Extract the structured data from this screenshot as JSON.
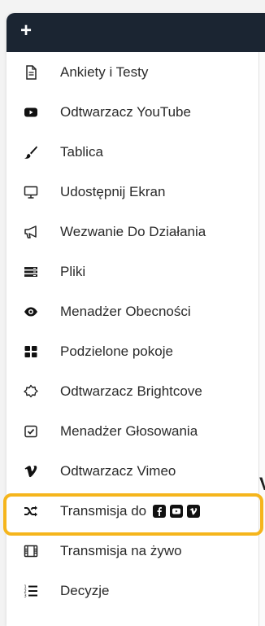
{
  "topbar": {
    "add_label": "+"
  },
  "menu": {
    "items": [
      {
        "label": "Ankiety i Testy",
        "icon": "document-icon"
      },
      {
        "label": "Odtwarzacz YouTube",
        "icon": "youtube-icon"
      },
      {
        "label": "Tablica",
        "icon": "brush-icon"
      },
      {
        "label": "Udostępnij Ekran",
        "icon": "monitor-icon"
      },
      {
        "label": "Wezwanie Do Działania",
        "icon": "megaphone-icon"
      },
      {
        "label": "Pliki",
        "icon": "files-icon"
      },
      {
        "label": "Menadżer Obecności",
        "icon": "eye-icon"
      },
      {
        "label": "Podzielone pokoje",
        "icon": "grid-icon"
      },
      {
        "label": "Odtwarzacz Brightcove",
        "icon": "brightcove-icon"
      },
      {
        "label": "Menadżer Głosowania",
        "icon": "checkbox-icon"
      },
      {
        "label": "Odtwarzacz Vimeo",
        "icon": "vimeo-icon"
      },
      {
        "label": "Transmisja do",
        "icon": "shuffle-icon"
      },
      {
        "label": "Transmisja na żywo",
        "icon": "film-icon"
      },
      {
        "label": "Decyzje",
        "icon": "list-icon"
      }
    ],
    "stream_platforms": [
      "facebook-icon",
      "youtube-icon",
      "vimeo-icon"
    ]
  },
  "highlight_color": "#f5b51c",
  "topbar_color": "#1b2532"
}
